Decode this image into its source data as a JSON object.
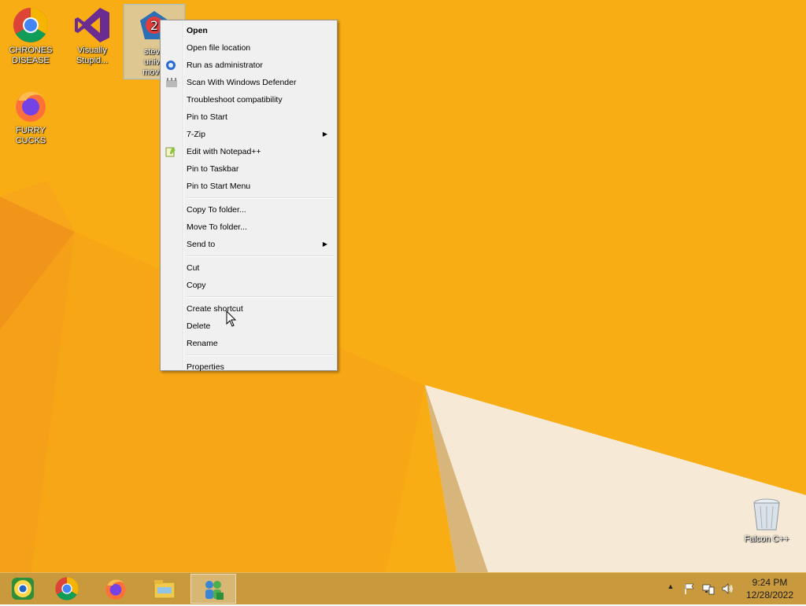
{
  "desktop": {
    "icons": [
      {
        "label_line1": "CHRONES",
        "label_line2": "DISEASE",
        "icon": "chrome-icon"
      },
      {
        "label_line1": "Visually",
        "label_line2": "Stupid...",
        "icon": "visual-studio-icon"
      },
      {
        "label_line1": "steve",
        "label_line2": "unive",
        "label_line3": "movie",
        "icon": "shortcut-app-icon"
      },
      {
        "label_line1": "FURRY CUCKS",
        "icon": "firefox-icon"
      },
      {
        "label_line1": "Falcon C++",
        "icon": "recycle-bin-icon"
      }
    ]
  },
  "context_menu": {
    "items": [
      {
        "label": "Open",
        "bold": true
      },
      {
        "label": "Open file location"
      },
      {
        "label": "Run as administrator",
        "icon": "uac-shield-icon"
      },
      {
        "label": "Scan With Windows Defender",
        "icon": "defender-icon"
      },
      {
        "label": "Troubleshoot compatibility"
      },
      {
        "label": "Pin to Start"
      },
      {
        "label": "7-Zip",
        "submenu": true
      },
      {
        "label": "Edit with Notepad++",
        "icon": "notepadpp-icon"
      },
      {
        "label": "Pin to Taskbar"
      },
      {
        "label": "Pin to Start Menu"
      },
      {
        "label": "Copy To folder..."
      },
      {
        "label": "Move To folder..."
      },
      {
        "label": "Send to",
        "submenu": true
      },
      {
        "label": "Cut"
      },
      {
        "label": "Copy"
      },
      {
        "label": "Create shortcut"
      },
      {
        "label": "Delete"
      },
      {
        "label": "Rename"
      },
      {
        "label": "Properties"
      }
    ],
    "submenu_arrow": "▶"
  },
  "taskbar": {
    "buttons": [
      "chromium-icon",
      "chrome-icon",
      "firefox-icon",
      "file-explorer-icon",
      "network-app-icon"
    ],
    "tray": {
      "show_hidden": "▲",
      "time": "9:24 PM",
      "date": "12/28/2022"
    }
  },
  "colors": {
    "wallpaper": "#f7aa14",
    "taskbar": "#c99a3d",
    "menu_bg": "#f0f0f0"
  }
}
